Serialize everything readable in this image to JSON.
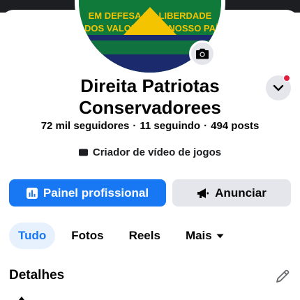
{
  "profile": {
    "avatar_banner_line1": "EM DEFESA DA LIBERDADE",
    "avatar_banner_line2": "E DOS VALORES DO NOSSO PAÍS",
    "name_line1": "Direita Patriotas",
    "name_line2": "Conservadorees",
    "followers": "72 mil seguidores",
    "following": "11 seguindo",
    "posts": "494 posts",
    "separator": "·",
    "category": "Criador de vídeo de jogos"
  },
  "actions": {
    "primary_label": "Painel profissional",
    "secondary_label": "Anunciar"
  },
  "tabs": [
    {
      "label": "Tudo",
      "active": true
    },
    {
      "label": "Fotos",
      "active": false
    },
    {
      "label": "Reels",
      "active": false
    },
    {
      "label": "Mais",
      "active": false
    }
  ],
  "details": {
    "title": "Detalhes"
  },
  "colors": {
    "accent": "#1877f2",
    "notification": "#e41e3f",
    "avatar_green": "#0f7a3a",
    "avatar_yellow": "#f5c400"
  },
  "icons": [
    "camera-icon",
    "chevron-down-icon",
    "video-camera-icon",
    "bar-chart-icon",
    "megaphone-icon",
    "caret-down-icon",
    "pencil-icon"
  ]
}
